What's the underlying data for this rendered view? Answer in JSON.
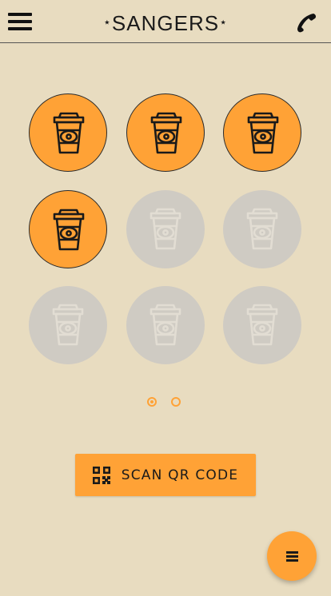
{
  "header": {
    "brand_prefix": "⋆",
    "brand_name": "SANGERS",
    "brand_suffix": "⋆"
  },
  "stamp_card": {
    "total_stamps": 9,
    "collected_stamps": 4,
    "stamp_icon": "coffee-cup-icon",
    "filled_color": "#ffa236",
    "empty_color": "#cfcbc3",
    "pages": 2,
    "current_page": 1
  },
  "actions": {
    "scan_label": "SCAN QR CODE",
    "scan_icon": "qr-code-icon",
    "fab_icon": "menu-icon"
  },
  "colors": {
    "background": "#e8dcc0",
    "accent": "#ffa236"
  }
}
